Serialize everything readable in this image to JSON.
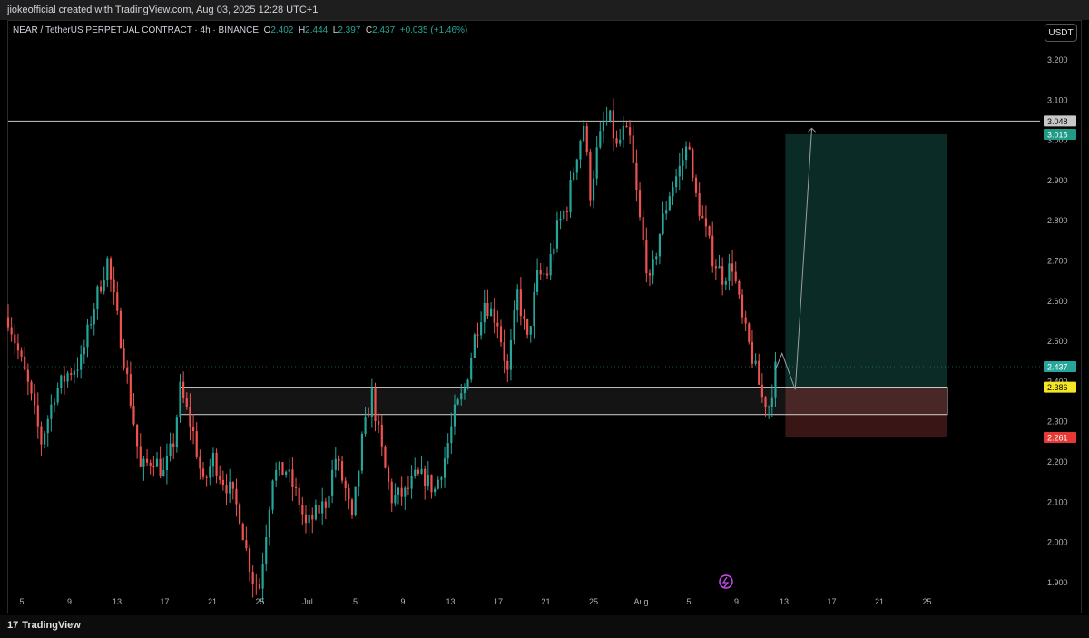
{
  "header": {
    "watermark_text": "jiokeofficial created with TradingView.com, Aug 03, 2025 12:28 UTC+1"
  },
  "symbol": {
    "title": "NEAR / TetherUS PERPETUAL CONTRACT · 4h · BINANCE",
    "o_label": "O",
    "o_value": "2.402",
    "h_label": "H",
    "h_value": "2.444",
    "l_label": "L",
    "l_value": "2.397",
    "c_label": "C",
    "c_value": "2.437",
    "change": "+0.035 (+1.46%)"
  },
  "currency_button": "USDT",
  "footer": {
    "brand": "TradingView",
    "logo": "17"
  },
  "colors": {
    "up": "#26a69a",
    "down": "#ef5350",
    "bg": "#000000",
    "target_zone": "#0b2b26",
    "stop_zone": "#3a1515",
    "zone_border": "#d0d0d0",
    "entry_line": "#c8c020"
  },
  "icons": {
    "lightning": "lightning-icon"
  },
  "chart_data": {
    "type": "candlestick",
    "timeframe": "4h",
    "y_ticks": [
      "3.200",
      "3.100",
      "3.000",
      "2.900",
      "2.800",
      "2.700",
      "2.600",
      "2.500",
      "2.400",
      "2.300",
      "2.200",
      "2.100",
      "2.000",
      "1.900"
    ],
    "ylim": [
      1.88,
      3.26
    ],
    "x_ticks": [
      "5",
      "9",
      "13",
      "17",
      "21",
      "25",
      "Jul",
      "5",
      "9",
      "13",
      "17",
      "21",
      "25",
      "Aug",
      "5",
      "9",
      "13",
      "17",
      "21",
      "25"
    ],
    "price_labels": [
      {
        "text": "3.048",
        "value": 3.048,
        "kind": "level"
      },
      {
        "text": "3.015",
        "value": 3.015,
        "kind": "target"
      },
      {
        "text": "2.437",
        "value": 2.437,
        "kind": "current"
      },
      {
        "text": "2.386",
        "value": 2.386,
        "kind": "entry"
      },
      {
        "text": "2.261",
        "value": 2.261,
        "kind": "stop"
      }
    ],
    "horizontal_level": 3.048,
    "support_zone": {
      "top": 2.386,
      "bottom": 2.318
    },
    "position": {
      "entry": 2.386,
      "target": 3.015,
      "stop": 2.261
    },
    "price_path": [
      [
        0,
        2.56
      ],
      [
        6,
        2.39
      ],
      [
        10,
        2.25
      ],
      [
        14,
        2.37
      ],
      [
        18,
        2.42
      ],
      [
        22,
        2.45
      ],
      [
        26,
        2.59
      ],
      [
        30,
        2.7
      ],
      [
        31,
        2.65
      ],
      [
        35,
        2.46
      ],
      [
        38,
        2.3
      ],
      [
        40,
        2.18
      ],
      [
        44,
        2.21
      ],
      [
        47,
        2.17
      ],
      [
        50,
        2.25
      ],
      [
        52,
        2.38
      ],
      [
        56,
        2.27
      ],
      [
        59,
        2.14
      ],
      [
        62,
        2.21
      ],
      [
        64,
        2.17
      ],
      [
        67,
        2.13
      ],
      [
        70,
        2.07
      ],
      [
        72,
        1.98
      ],
      [
        74,
        1.91
      ],
      [
        76,
        1.89
      ],
      [
        78,
        2.03
      ],
      [
        80,
        2.17
      ],
      [
        84,
        2.18
      ],
      [
        88,
        2.1
      ],
      [
        90,
        2.04
      ],
      [
        93,
        2.07
      ],
      [
        96,
        2.1
      ],
      [
        99,
        2.21
      ],
      [
        102,
        2.13
      ],
      [
        104,
        2.05
      ],
      [
        107,
        2.25
      ],
      [
        110,
        2.37
      ],
      [
        112,
        2.27
      ],
      [
        114,
        2.18
      ],
      [
        116,
        2.11
      ],
      [
        120,
        2.12
      ],
      [
        123,
        2.16
      ],
      [
        126,
        2.16
      ],
      [
        129,
        2.13
      ],
      [
        132,
        2.21
      ],
      [
        135,
        2.32
      ],
      [
        138,
        2.38
      ],
      [
        141,
        2.51
      ],
      [
        144,
        2.6
      ],
      [
        148,
        2.55
      ],
      [
        151,
        2.42
      ],
      [
        154,
        2.62
      ],
      [
        157,
        2.5
      ],
      [
        160,
        2.66
      ],
      [
        163,
        2.67
      ],
      [
        166,
        2.78
      ],
      [
        169,
        2.84
      ],
      [
        172,
        2.97
      ],
      [
        174,
        3.04
      ],
      [
        176,
        2.87
      ],
      [
        178,
        2.97
      ],
      [
        180,
        3.04
      ],
      [
        182,
        3.05
      ],
      [
        184,
        2.98
      ],
      [
        186,
        3.02
      ],
      [
        188,
        3.0
      ],
      [
        191,
        2.8
      ],
      [
        194,
        2.64
      ],
      [
        197,
        2.77
      ],
      [
        200,
        2.87
      ],
      [
        203,
        2.93
      ],
      [
        206,
        3.0
      ],
      [
        207,
        2.89
      ],
      [
        210,
        2.8
      ],
      [
        213,
        2.71
      ],
      [
        216,
        2.66
      ],
      [
        219,
        2.69
      ],
      [
        222,
        2.55
      ],
      [
        225,
        2.46
      ],
      [
        228,
        2.36
      ],
      [
        230,
        2.34
      ],
      [
        232,
        2.43
      ]
    ],
    "ghost_path": [
      [
        232,
        2.43
      ],
      [
        234,
        2.47
      ],
      [
        238,
        2.38
      ],
      [
        243,
        3.03
      ]
    ],
    "last_index": 232,
    "x_range": [
      0,
      312
    ]
  }
}
